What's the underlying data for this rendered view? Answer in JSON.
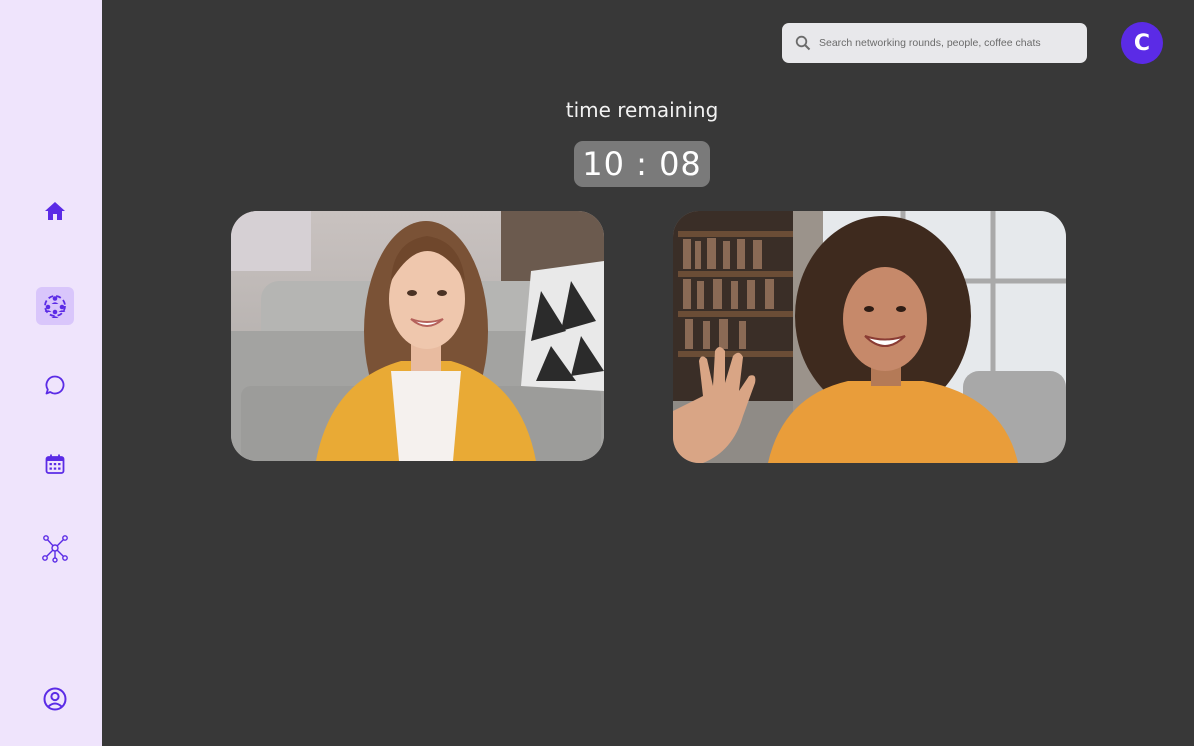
{
  "sidebar": {
    "items": [
      {
        "name": "home",
        "icon": "home-icon"
      },
      {
        "name": "networking-rounds",
        "icon": "people-network-icon",
        "active": true
      },
      {
        "name": "chat",
        "icon": "chat-bubble-icon"
      },
      {
        "name": "calendar",
        "icon": "calendar-icon"
      },
      {
        "name": "connections",
        "icon": "network-nodes-icon"
      },
      {
        "name": "profile",
        "icon": "user-circle-icon"
      }
    ]
  },
  "header": {
    "search": {
      "placeholder": "Search networking rounds, people, coffee chats",
      "value": ""
    },
    "avatar_initial": "C"
  },
  "session": {
    "timer_label": "time remaining",
    "timer_value": "10 : 08"
  },
  "participants": [
    {
      "name": "participant-1"
    },
    {
      "name": "participant-2"
    }
  ],
  "colors": {
    "accent": "#5b2be6",
    "sidebar_bg": "#efe4fc",
    "active_item_bg": "#d9c6fb",
    "main_bg": "#383838",
    "timer_bg": "#7a7a7a",
    "search_bg": "#e8e8eb"
  }
}
